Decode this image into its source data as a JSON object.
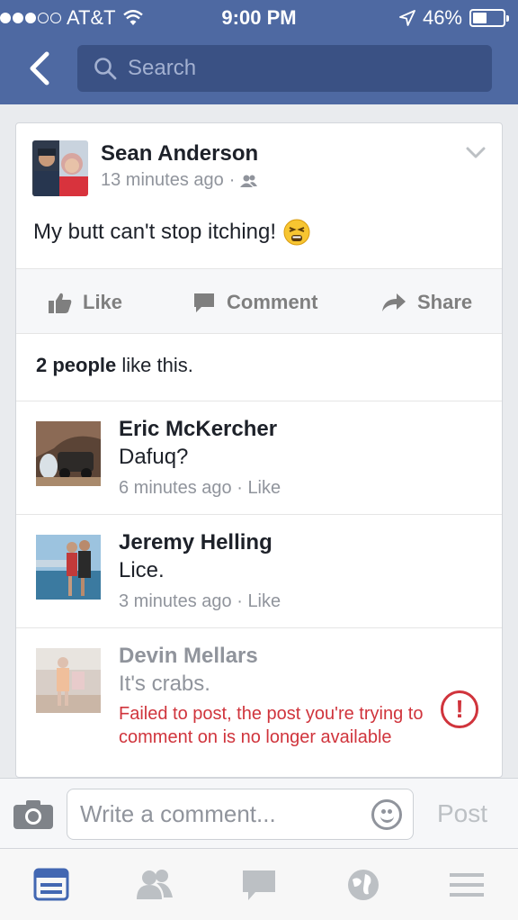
{
  "status_bar": {
    "carrier": "AT&T",
    "time": "9:00 PM",
    "battery": "46%",
    "battery_level": 0.46
  },
  "search": {
    "placeholder": "Search"
  },
  "post": {
    "author": "Sean Anderson",
    "time": "13 minutes ago",
    "separator": "·",
    "text": "My butt can't stop itching!",
    "emoji": "tired-face-emoji"
  },
  "actions": {
    "like": "Like",
    "comment": "Comment",
    "share": "Share"
  },
  "likes": {
    "count": "2 people",
    "suffix": " like this."
  },
  "comments": [
    {
      "name": "Eric McKercher",
      "text": "Dafuq?",
      "time": "6 minutes ago",
      "like": "Like"
    },
    {
      "name": "Jeremy Helling",
      "text": "Lice.",
      "time": "3 minutes ago",
      "like": "Like"
    },
    {
      "name": "Devin Mellars",
      "text": "It's crabs.",
      "error": "Failed to post, the post you're trying to comment on is no longer available"
    }
  ],
  "composer": {
    "placeholder": "Write a comment...",
    "post_label": "Post"
  },
  "tabs": [
    "news-feed-icon",
    "friends-icon",
    "messages-icon",
    "globe-icon",
    "menu-icon"
  ],
  "colors": {
    "header": "#4e69a2",
    "search": "#3a5184",
    "error": "#d0343c",
    "active_tab": "#4267b2"
  }
}
